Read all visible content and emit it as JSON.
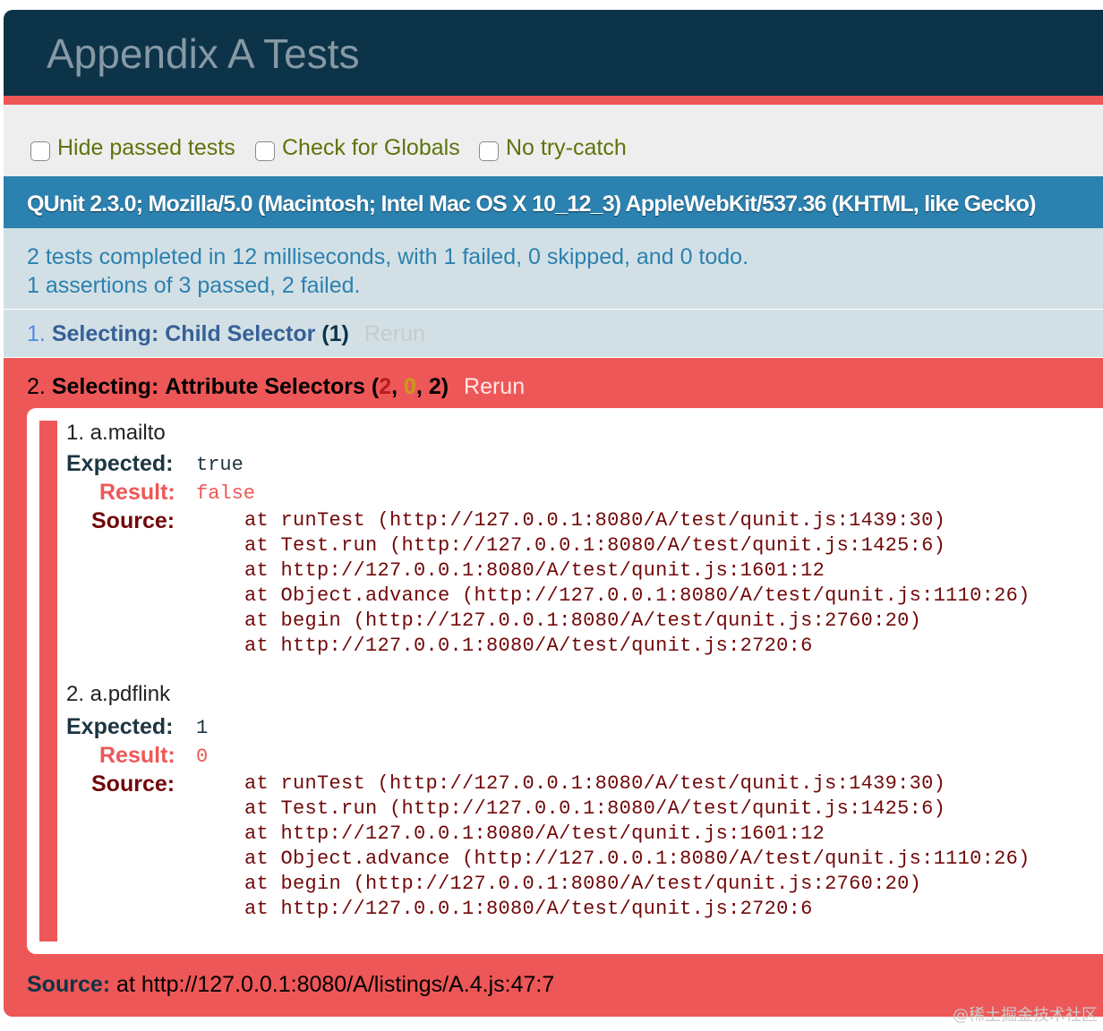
{
  "header": {
    "title": "Appendix A Tests"
  },
  "toolbar": {
    "options": [
      {
        "label": "Hide passed tests"
      },
      {
        "label": "Check for Globals"
      },
      {
        "label": "No try-catch"
      }
    ]
  },
  "useragent": "QUnit 2.3.0; Mozilla/5.0 (Macintosh; Intel Mac OS X 10_12_3) AppleWebKit/537.36 (KHTML, like Gecko)",
  "summary": {
    "line1": "2 tests completed in 12 milliseconds, with 1 failed, 0 skipped, and 0 todo.",
    "line2": "1 assertions of 3 passed, 2 failed."
  },
  "tests": [
    {
      "number": "1.",
      "module": "Selecting:",
      "name": "Child Selector",
      "counts_text": "(1)",
      "rerun": "Rerun"
    },
    {
      "number": "2.",
      "module": "Selecting:",
      "name": "Attribute Selectors",
      "bad": "2",
      "good": "0",
      "total": "2",
      "rerun": "Rerun",
      "assertions": [
        {
          "title": "1. a.mailto",
          "expected_label": "Expected:",
          "expected": "true",
          "result_label": "Result:",
          "result": "false",
          "source_label": "Source:",
          "trace": "    at runTest (http://127.0.0.1:8080/A/test/qunit.js:1439:30)\n    at Test.run (http://127.0.0.1:8080/A/test/qunit.js:1425:6)\n    at http://127.0.0.1:8080/A/test/qunit.js:1601:12\n    at Object.advance (http://127.0.0.1:8080/A/test/qunit.js:1110:26)\n    at begin (http://127.0.0.1:8080/A/test/qunit.js:2760:20)\n    at http://127.0.0.1:8080/A/test/qunit.js:2720:6"
        },
        {
          "title": "2. a.pdflink",
          "expected_label": "Expected:",
          "expected": "1",
          "result_label": "Result:",
          "result": "0",
          "source_label": "Source:",
          "trace": "    at runTest (http://127.0.0.1:8080/A/test/qunit.js:1439:30)\n    at Test.run (http://127.0.0.1:8080/A/test/qunit.js:1425:6)\n    at http://127.0.0.1:8080/A/test/qunit.js:1601:12\n    at Object.advance (http://127.0.0.1:8080/A/test/qunit.js:1110:26)\n    at begin (http://127.0.0.1:8080/A/test/qunit.js:2760:20)\n    at http://127.0.0.1:8080/A/test/qunit.js:2720:6"
        }
      ],
      "source_label": "Source:",
      "source": "at http://127.0.0.1:8080/A/listings/A.4.js:47:7"
    }
  ],
  "watermark": "@稀土掘金技术社区",
  "colors": {
    "header_bg": "#0d3349",
    "fail_red": "#ee5757",
    "useragent_bg": "#2b81af",
    "pass_bg": "#d2e0e6"
  }
}
